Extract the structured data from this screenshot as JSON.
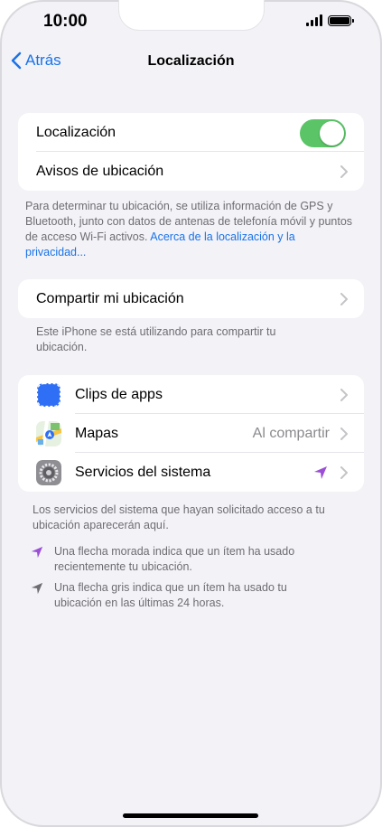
{
  "status": {
    "time": "10:00"
  },
  "nav": {
    "back_label": "Atrás",
    "title": "Localización"
  },
  "group1": {
    "rows": [
      {
        "label": "Localización",
        "toggle_on": true
      },
      {
        "label": "Avisos de ubicación"
      }
    ]
  },
  "footnote1": {
    "text": "Para determinar tu ubicación, se utiliza información de GPS y Bluetooth, junto con datos de antenas de telefonía móvil y puntos de acceso Wi-Fi activos. ",
    "link": "Acerca de la localización y la privacidad..."
  },
  "group2": {
    "rows": [
      {
        "label": "Compartir mi ubicación"
      }
    ]
  },
  "footnote2": {
    "text": "Este iPhone se está utilizando para compartir tu ubicación."
  },
  "group3": {
    "rows": [
      {
        "label": "Clips de apps",
        "icon": "app-clips-icon"
      },
      {
        "label": "Mapas",
        "value": "Al compartir",
        "icon": "maps-icon"
      },
      {
        "label": "Servicios del sistema",
        "icon": "settings-gear-icon",
        "indicator": "location-arrow-purple"
      }
    ]
  },
  "footnote3": {
    "text": "Los servicios del sistema que hayan solicitado acceso a tu ubicación aparecerán aquí."
  },
  "legend": {
    "purple": "Una flecha morada indica que un ítem ha usado recientemente tu ubicación.",
    "gray": "Una flecha gris indica que un ítem ha usado tu ubicación en las últimas 24 horas."
  },
  "colors": {
    "accent": "#1a73e8",
    "toggle": "#5ac467",
    "purple_arrow": "#9b4fd6",
    "gray_arrow": "#6d6d72"
  }
}
